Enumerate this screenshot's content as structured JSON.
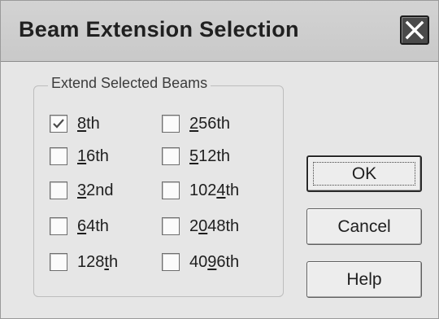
{
  "dialog": {
    "title": "Beam Extension Selection",
    "close_icon": "close-icon"
  },
  "group": {
    "legend": "Extend Selected Beams",
    "options": [
      {
        "pre": "",
        "key": "8",
        "post": "th",
        "checked": true
      },
      {
        "pre": "",
        "key": "1",
        "post": "6th",
        "checked": false
      },
      {
        "pre": "",
        "key": "3",
        "post": "2nd",
        "checked": false
      },
      {
        "pre": "",
        "key": "6",
        "post": "4th",
        "checked": false
      },
      {
        "pre": "128",
        "key": "t",
        "post": "h",
        "checked": false
      },
      {
        "pre": "",
        "key": "2",
        "post": "56th",
        "checked": false
      },
      {
        "pre": "",
        "key": "5",
        "post": "12th",
        "checked": false
      },
      {
        "pre": "102",
        "key": "4",
        "post": "th",
        "checked": false
      },
      {
        "pre": "2",
        "key": "0",
        "post": "48th",
        "checked": false
      },
      {
        "pre": "40",
        "key": "9",
        "post": "6th",
        "checked": false
      }
    ]
  },
  "buttons": {
    "ok": "OK",
    "cancel": "Cancel",
    "help": "Help"
  }
}
